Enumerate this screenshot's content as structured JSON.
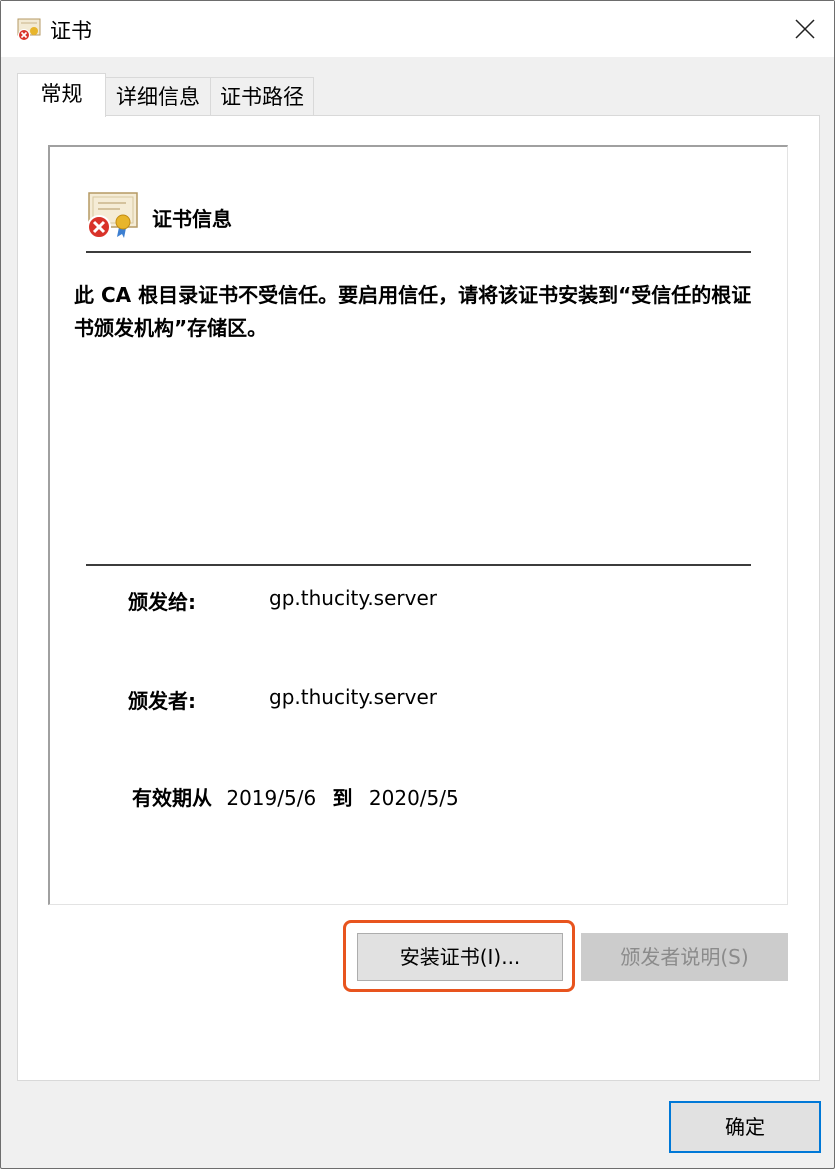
{
  "window": {
    "title": "证书"
  },
  "tabs": [
    "常规",
    "详细信息",
    "证书路径"
  ],
  "general": {
    "section_title": "证书信息",
    "warning": "此 CA 根目录证书不受信任。要启用信任，请将该证书安装到“受信任的根证书颁发机构”存储区。",
    "issued_to_label": "颁发给:",
    "issued_to_value": "gp.thucity.server",
    "issued_by_label": "颁发者:",
    "issued_by_value": "gp.thucity.server",
    "valid_from_label": "有效期从",
    "valid_from": "2019/5/6",
    "valid_to_label": "到",
    "valid_to": "2020/5/5"
  },
  "buttons": {
    "install": "安装证书(I)...",
    "issuer_statement": "颁发者说明(S)",
    "ok": "确定"
  },
  "colors": {
    "highlight": "#e8541e",
    "focus_border": "#0078d7"
  }
}
